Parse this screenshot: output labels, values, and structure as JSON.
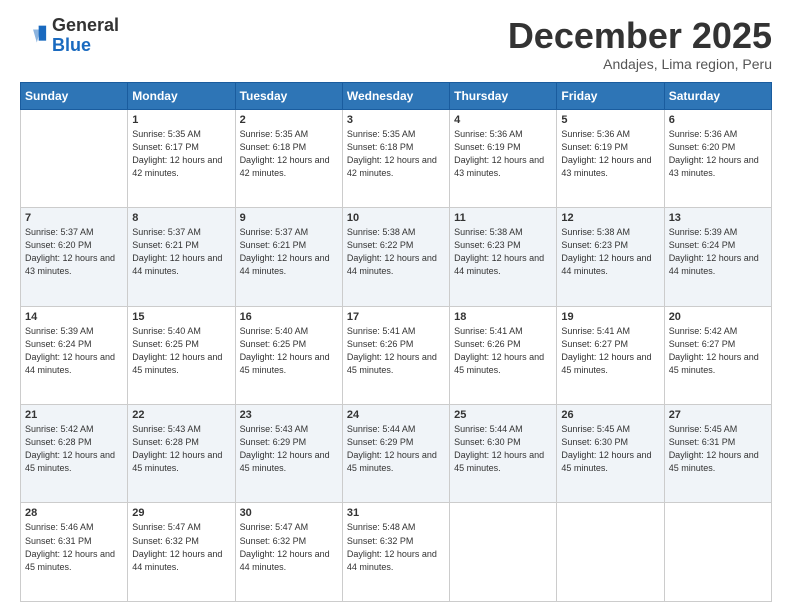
{
  "logo": {
    "general": "General",
    "blue": "Blue"
  },
  "header": {
    "month_title": "December 2025",
    "subtitle": "Andajes, Lima region, Peru"
  },
  "days_of_week": [
    "Sunday",
    "Monday",
    "Tuesday",
    "Wednesday",
    "Thursday",
    "Friday",
    "Saturday"
  ],
  "weeks": [
    [
      {
        "day": "",
        "sunrise": "",
        "sunset": "",
        "daylight": ""
      },
      {
        "day": "1",
        "sunrise": "Sunrise: 5:35 AM",
        "sunset": "Sunset: 6:17 PM",
        "daylight": "Daylight: 12 hours and 42 minutes."
      },
      {
        "day": "2",
        "sunrise": "Sunrise: 5:35 AM",
        "sunset": "Sunset: 6:18 PM",
        "daylight": "Daylight: 12 hours and 42 minutes."
      },
      {
        "day": "3",
        "sunrise": "Sunrise: 5:35 AM",
        "sunset": "Sunset: 6:18 PM",
        "daylight": "Daylight: 12 hours and 42 minutes."
      },
      {
        "day": "4",
        "sunrise": "Sunrise: 5:36 AM",
        "sunset": "Sunset: 6:19 PM",
        "daylight": "Daylight: 12 hours and 43 minutes."
      },
      {
        "day": "5",
        "sunrise": "Sunrise: 5:36 AM",
        "sunset": "Sunset: 6:19 PM",
        "daylight": "Daylight: 12 hours and 43 minutes."
      },
      {
        "day": "6",
        "sunrise": "Sunrise: 5:36 AM",
        "sunset": "Sunset: 6:20 PM",
        "daylight": "Daylight: 12 hours and 43 minutes."
      }
    ],
    [
      {
        "day": "7",
        "sunrise": "Sunrise: 5:37 AM",
        "sunset": "Sunset: 6:20 PM",
        "daylight": "Daylight: 12 hours and 43 minutes."
      },
      {
        "day": "8",
        "sunrise": "Sunrise: 5:37 AM",
        "sunset": "Sunset: 6:21 PM",
        "daylight": "Daylight: 12 hours and 44 minutes."
      },
      {
        "day": "9",
        "sunrise": "Sunrise: 5:37 AM",
        "sunset": "Sunset: 6:21 PM",
        "daylight": "Daylight: 12 hours and 44 minutes."
      },
      {
        "day": "10",
        "sunrise": "Sunrise: 5:38 AM",
        "sunset": "Sunset: 6:22 PM",
        "daylight": "Daylight: 12 hours and 44 minutes."
      },
      {
        "day": "11",
        "sunrise": "Sunrise: 5:38 AM",
        "sunset": "Sunset: 6:23 PM",
        "daylight": "Daylight: 12 hours and 44 minutes."
      },
      {
        "day": "12",
        "sunrise": "Sunrise: 5:38 AM",
        "sunset": "Sunset: 6:23 PM",
        "daylight": "Daylight: 12 hours and 44 minutes."
      },
      {
        "day": "13",
        "sunrise": "Sunrise: 5:39 AM",
        "sunset": "Sunset: 6:24 PM",
        "daylight": "Daylight: 12 hours and 44 minutes."
      }
    ],
    [
      {
        "day": "14",
        "sunrise": "Sunrise: 5:39 AM",
        "sunset": "Sunset: 6:24 PM",
        "daylight": "Daylight: 12 hours and 44 minutes."
      },
      {
        "day": "15",
        "sunrise": "Sunrise: 5:40 AM",
        "sunset": "Sunset: 6:25 PM",
        "daylight": "Daylight: 12 hours and 45 minutes."
      },
      {
        "day": "16",
        "sunrise": "Sunrise: 5:40 AM",
        "sunset": "Sunset: 6:25 PM",
        "daylight": "Daylight: 12 hours and 45 minutes."
      },
      {
        "day": "17",
        "sunrise": "Sunrise: 5:41 AM",
        "sunset": "Sunset: 6:26 PM",
        "daylight": "Daylight: 12 hours and 45 minutes."
      },
      {
        "day": "18",
        "sunrise": "Sunrise: 5:41 AM",
        "sunset": "Sunset: 6:26 PM",
        "daylight": "Daylight: 12 hours and 45 minutes."
      },
      {
        "day": "19",
        "sunrise": "Sunrise: 5:41 AM",
        "sunset": "Sunset: 6:27 PM",
        "daylight": "Daylight: 12 hours and 45 minutes."
      },
      {
        "day": "20",
        "sunrise": "Sunrise: 5:42 AM",
        "sunset": "Sunset: 6:27 PM",
        "daylight": "Daylight: 12 hours and 45 minutes."
      }
    ],
    [
      {
        "day": "21",
        "sunrise": "Sunrise: 5:42 AM",
        "sunset": "Sunset: 6:28 PM",
        "daylight": "Daylight: 12 hours and 45 minutes."
      },
      {
        "day": "22",
        "sunrise": "Sunrise: 5:43 AM",
        "sunset": "Sunset: 6:28 PM",
        "daylight": "Daylight: 12 hours and 45 minutes."
      },
      {
        "day": "23",
        "sunrise": "Sunrise: 5:43 AM",
        "sunset": "Sunset: 6:29 PM",
        "daylight": "Daylight: 12 hours and 45 minutes."
      },
      {
        "day": "24",
        "sunrise": "Sunrise: 5:44 AM",
        "sunset": "Sunset: 6:29 PM",
        "daylight": "Daylight: 12 hours and 45 minutes."
      },
      {
        "day": "25",
        "sunrise": "Sunrise: 5:44 AM",
        "sunset": "Sunset: 6:30 PM",
        "daylight": "Daylight: 12 hours and 45 minutes."
      },
      {
        "day": "26",
        "sunrise": "Sunrise: 5:45 AM",
        "sunset": "Sunset: 6:30 PM",
        "daylight": "Daylight: 12 hours and 45 minutes."
      },
      {
        "day": "27",
        "sunrise": "Sunrise: 5:45 AM",
        "sunset": "Sunset: 6:31 PM",
        "daylight": "Daylight: 12 hours and 45 minutes."
      }
    ],
    [
      {
        "day": "28",
        "sunrise": "Sunrise: 5:46 AM",
        "sunset": "Sunset: 6:31 PM",
        "daylight": "Daylight: 12 hours and 45 minutes."
      },
      {
        "day": "29",
        "sunrise": "Sunrise: 5:47 AM",
        "sunset": "Sunset: 6:32 PM",
        "daylight": "Daylight: 12 hours and 44 minutes."
      },
      {
        "day": "30",
        "sunrise": "Sunrise: 5:47 AM",
        "sunset": "Sunset: 6:32 PM",
        "daylight": "Daylight: 12 hours and 44 minutes."
      },
      {
        "day": "31",
        "sunrise": "Sunrise: 5:48 AM",
        "sunset": "Sunset: 6:32 PM",
        "daylight": "Daylight: 12 hours and 44 minutes."
      },
      {
        "day": "",
        "sunrise": "",
        "sunset": "",
        "daylight": ""
      },
      {
        "day": "",
        "sunrise": "",
        "sunset": "",
        "daylight": ""
      },
      {
        "day": "",
        "sunrise": "",
        "sunset": "",
        "daylight": ""
      }
    ]
  ]
}
